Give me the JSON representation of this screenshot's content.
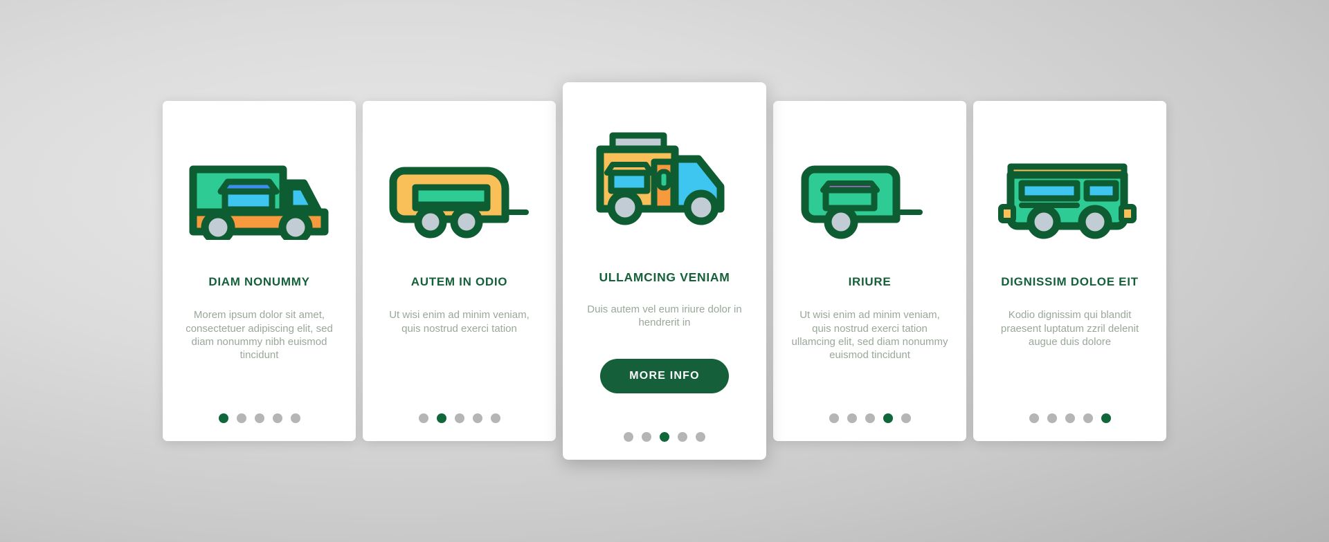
{
  "palette": {
    "brand_green": "#15603a",
    "mint": "#2ecb94",
    "amber": "#f9c05a",
    "orange": "#f79a3e",
    "sky": "#3fc6f0",
    "blue": "#3d8ef0",
    "wheel_grey": "#c2ccd4",
    "body_text": "#9aa79a",
    "dot_inactive": "#b5b5b5",
    "dot_active": "#10673a",
    "card_bg": "#ffffff"
  },
  "cards": [
    {
      "title": "DIAM NONUMMY",
      "body": "Morem ipsum dolor sit amet, consectetuer adipiscing elit, sed diam nonummy nibh euismod tincidunt",
      "icon": "pickup-truck-with-crate-icon",
      "featured": false,
      "button": null,
      "dots": {
        "count": 5,
        "active": 0
      }
    },
    {
      "title": "AUTEM IN ODIO",
      "body": "Ut wisi enim ad minim veniam, quis nostrud exerci tation",
      "icon": "caravan-trailer-icon",
      "featured": false,
      "button": null,
      "dots": {
        "count": 5,
        "active": 1
      }
    },
    {
      "title": "ULLAMCING VENIAM",
      "body": "Duis autem vel eum iriure dolor in hendrerit in",
      "icon": "food-truck-icon",
      "featured": true,
      "button": "MORE INFO",
      "dots": {
        "count": 5,
        "active": 2
      }
    },
    {
      "title": "IRIURE",
      "body": "Ut wisi enim ad minim veniam, quis nostrud exerci tation ullamcing elit, sed diam nonummy euismod tincidunt",
      "icon": "box-trailer-icon",
      "featured": false,
      "button": null,
      "dots": {
        "count": 5,
        "active": 3
      }
    },
    {
      "title": "DIGNISSIM DOLOE EIT",
      "body": "Kodio dignissim qui blandit praesent luptatum zzril delenit augue duis dolore",
      "icon": "camper-van-icon",
      "featured": false,
      "button": null,
      "dots": {
        "count": 5,
        "active": 4
      }
    }
  ]
}
